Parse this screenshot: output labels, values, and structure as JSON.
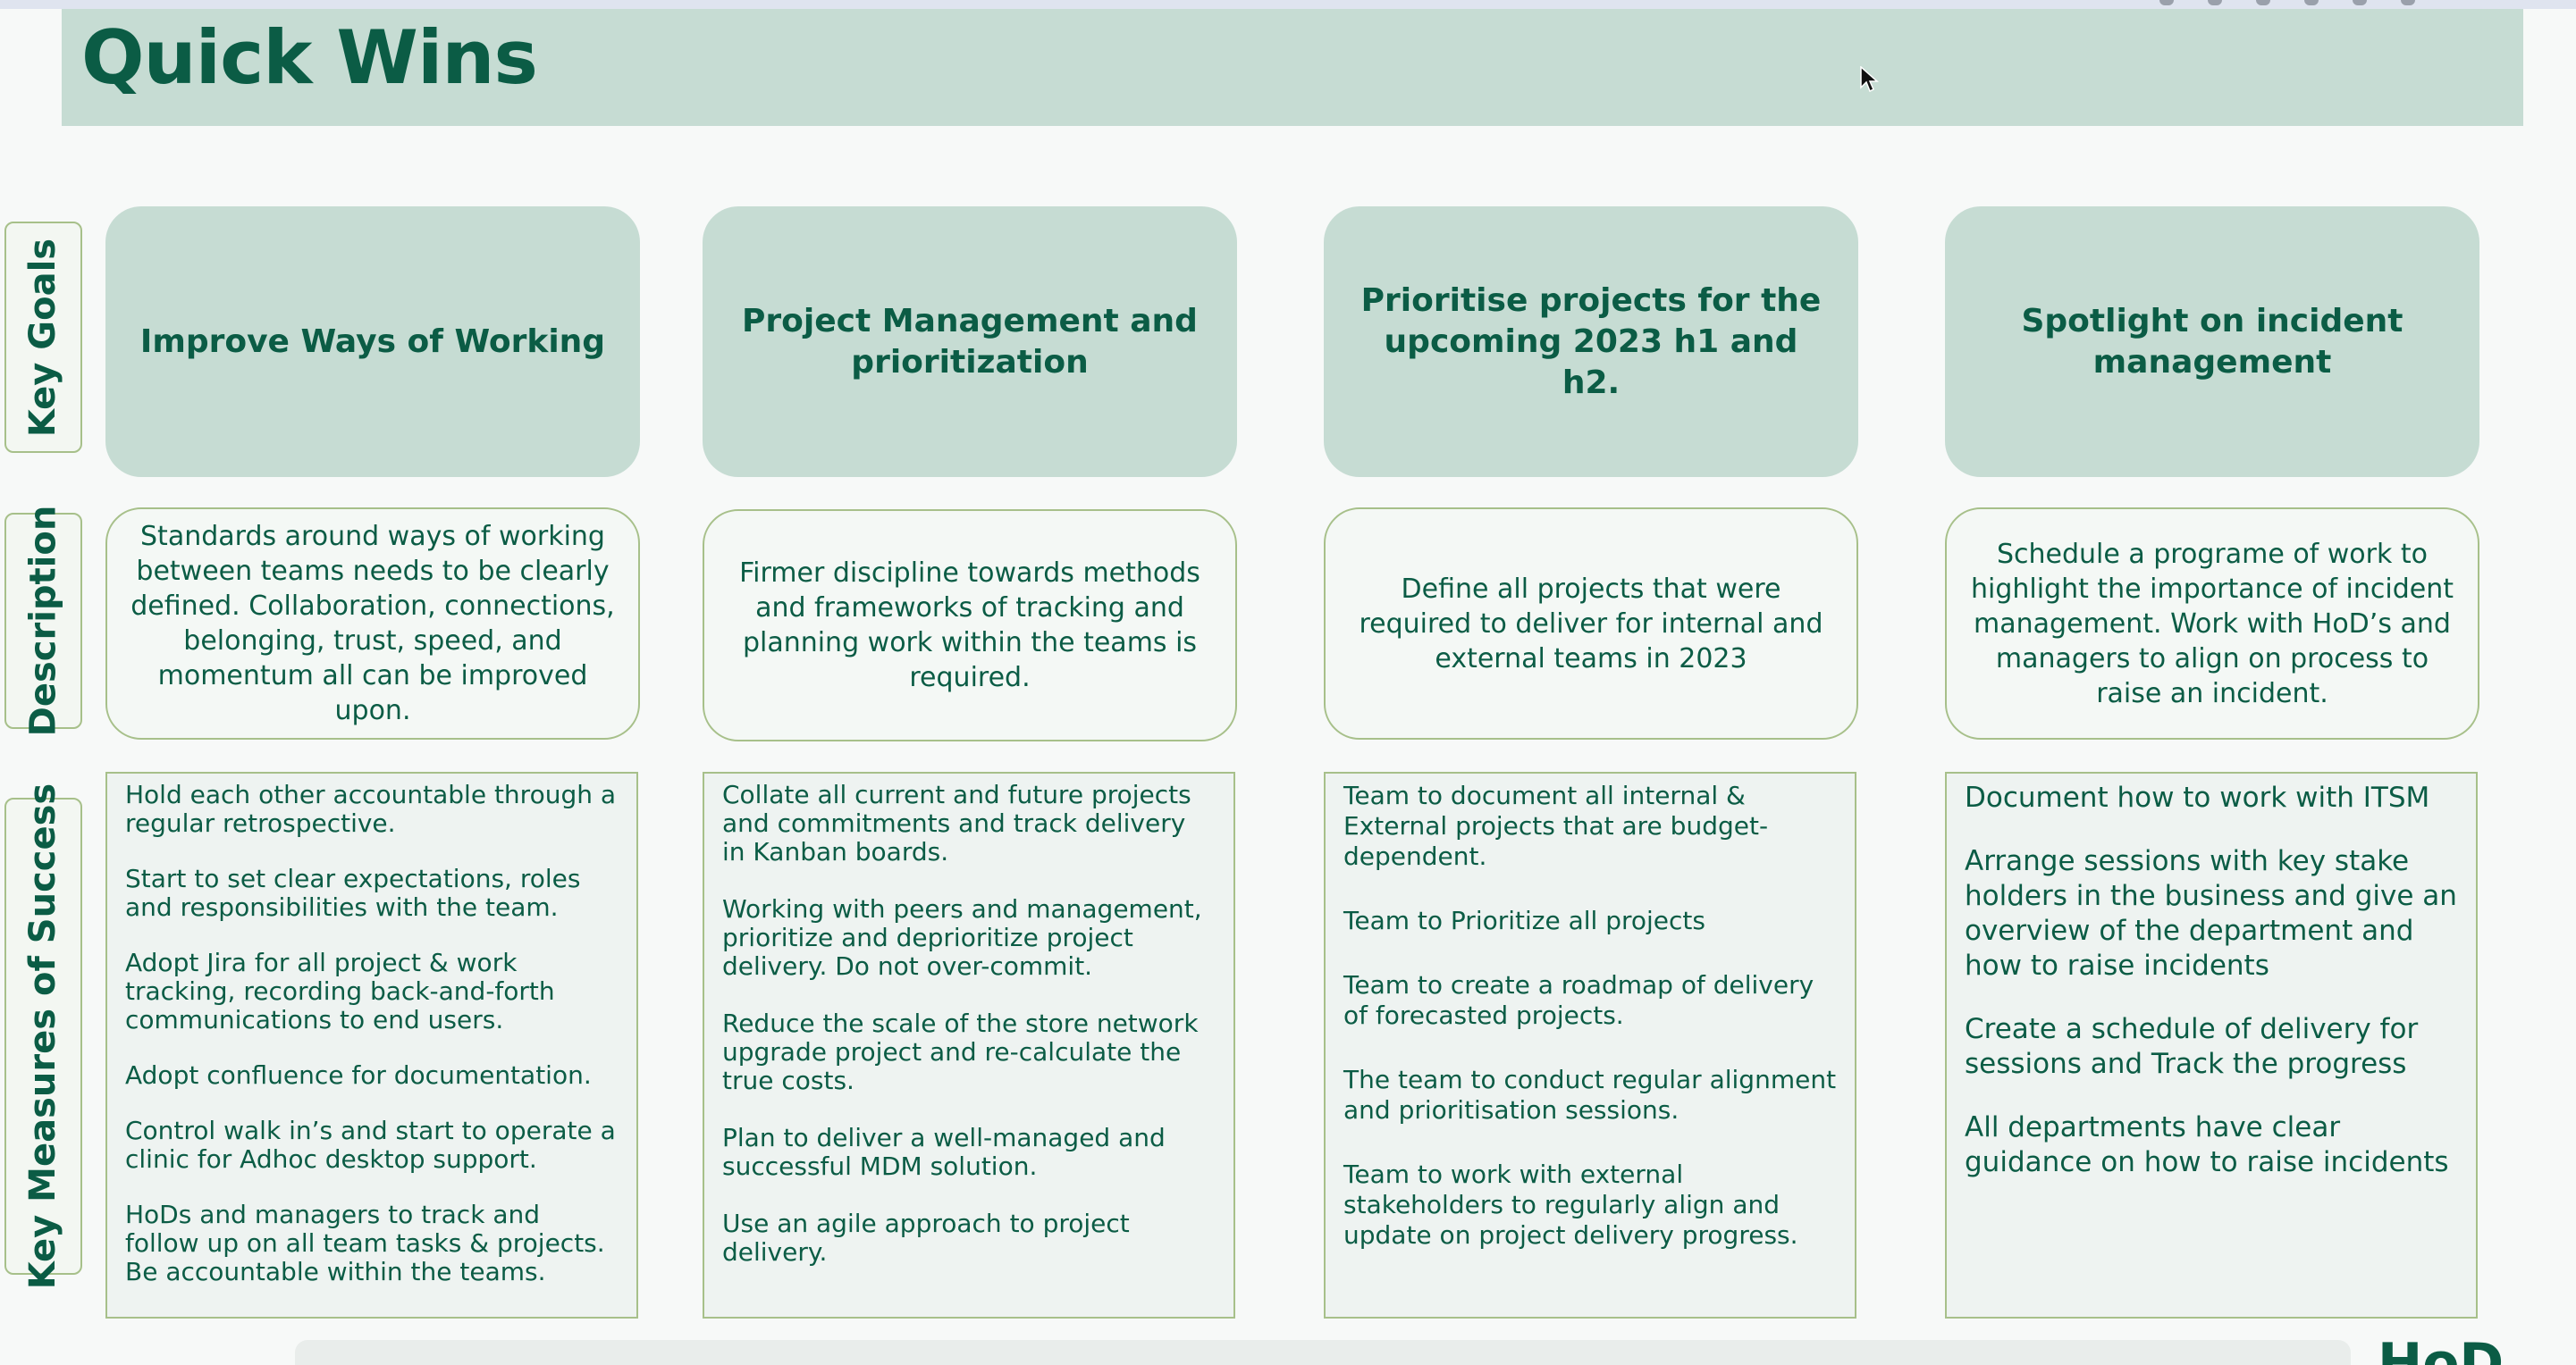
{
  "title": "Quick Wins",
  "logo_text": "HoD",
  "row_labels": {
    "goals": "Key Goals",
    "description": "Description",
    "kms": "Key Measures of Success"
  },
  "columns": [
    {
      "goal": "Improve Ways of Working",
      "description": "Standards around ways of working between teams needs to be clearly defined. Collaboration, connections, belonging, trust, speed, and momentum all can be improved upon.",
      "measures": [
        "Hold each other accountable through a regular retrospective.",
        "Start to set clear expectations, roles and responsibilities with the team.",
        "Adopt Jira for all project & work tracking, recording back-and-forth communications to end users.",
        "Adopt confluence for documentation.",
        "Control walk in’s and start to operate a clinic for Adhoc desktop support.",
        "HoDs and managers to track and follow up on all team tasks & projects. Be accountable within the teams."
      ]
    },
    {
      "goal": "Project Management and prioritization",
      "description": "Firmer discipline towards methods and frameworks of tracking and planning work within the teams is required.",
      "measures": [
        "Collate all current and future projects and commitments and track delivery in Kanban boards.",
        "Working with peers and management, prioritize and deprioritize project delivery. Do not over-commit.",
        "Reduce the scale of the store network upgrade project and re-calculate the true costs.",
        "Plan to deliver a well-managed and successful MDM solution.",
        "Use an agile approach to project delivery."
      ]
    },
    {
      "goal": "Prioritise projects for the upcoming 2023 h1 and h2.",
      "description": "Define all projects that were required to deliver for internal and external teams in 2023",
      "measures": [
        "Team to document all internal & External projects that are budget-dependent.",
        "Team to Prioritize all projects",
        "Team to create a roadmap of delivery of forecasted projects.",
        "The team to conduct regular alignment and prioritisation sessions.",
        "Team to work with external stakeholders to regularly align and update on project delivery progress."
      ]
    },
    {
      "goal": "Spotlight on incident management",
      "description": "Schedule a programe of work to highlight the importance of incident management. Work with HoD’s and managers to align on process to raise an incident.",
      "measures": [
        "Document how to work with ITSM",
        "Arrange sessions with key stake holders in the business and give an overview of the department and how to raise incidents",
        "Create a schedule of delivery for sessions and Track the progress",
        "All departments have clear guidance on how to raise incidents"
      ]
    }
  ]
}
